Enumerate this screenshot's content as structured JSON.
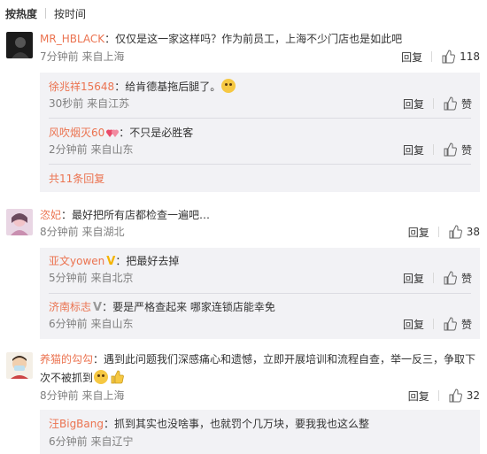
{
  "sort": {
    "hot": "按热度",
    "time": "按时间"
  },
  "comments": [
    {
      "user": "MR_HBLACK",
      "text": "：仅仅是这一家这样吗？作为前员工，上海不少门店也是如此吧",
      "meta": "7分钟前 来自上海",
      "reply_label": "回复",
      "likes": "118",
      "replies": [
        {
          "user": "徐兆祥15648",
          "text": "：给肯德基拖后腿了。",
          "meta": "30秒前 来自江苏",
          "reply_label": "回复",
          "like_label": "赞"
        },
        {
          "user": "风吹烟灭60",
          "text": "：不只是必胜客",
          "meta": "2分钟前 来自山东",
          "reply_label": "回复",
          "like_label": "赞"
        }
      ],
      "more": "共11条回复"
    },
    {
      "user": "恣妃",
      "text": "：最好把所有店都检查一遍吧…",
      "meta": "8分钟前 来自湖北",
      "reply_label": "回复",
      "likes": "38",
      "replies": [
        {
          "user": "亚文yowen",
          "text": "：把最好去掉",
          "meta": "5分钟前 来自北京",
          "reply_label": "回复",
          "like_label": "赞"
        },
        {
          "user": "济南标志",
          "text": "：要是严格查起来 哪家连锁店能幸免",
          "meta": "6分钟前 来自山东",
          "reply_label": "回复",
          "like_label": "赞"
        }
      ]
    },
    {
      "user": "养猫的勾勾",
      "text": "：遇到此问题我们深感痛心和遗憾，立即开展培训和流程自查，举一反三，争取下次不被抓到",
      "meta": "8分钟前 来自上海",
      "reply_label": "回复",
      "likes": "32",
      "replies": [
        {
          "user": "汪BigBang",
          "text": "：抓到其实也没啥事，也就罚个几万块，要我我也这么整",
          "meta": "6分钟前 来自辽宁"
        }
      ]
    }
  ],
  "colors": {
    "username": "#eb7350",
    "meta": "#808080",
    "reply_bg": "#f2f2f5"
  }
}
